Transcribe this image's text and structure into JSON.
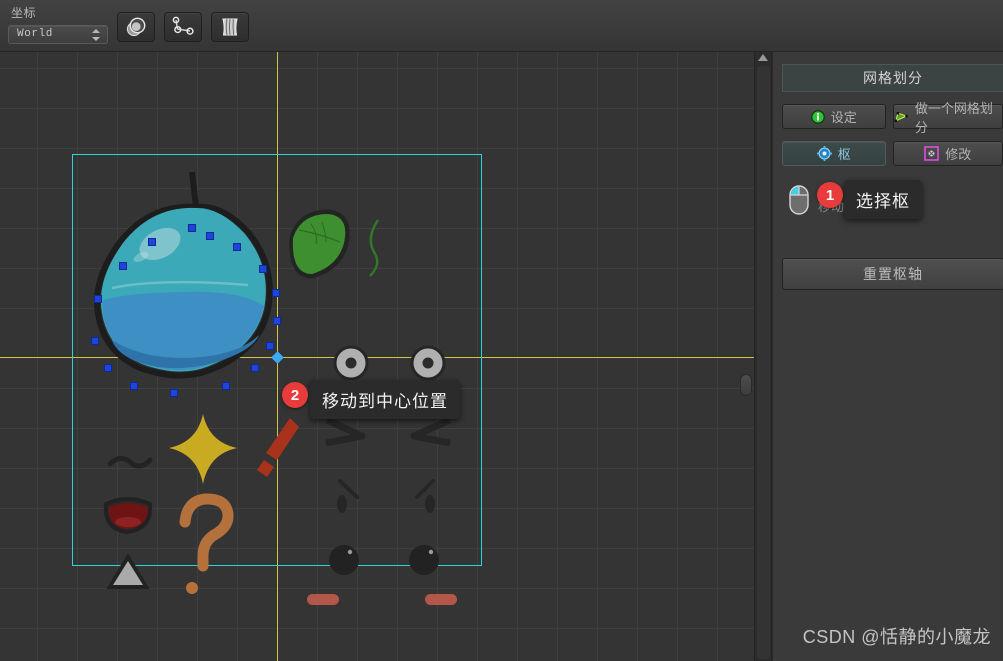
{
  "toolbar": {
    "coord_label": "坐标",
    "coord_value": "World",
    "buttons": [
      {
        "name": "shape-tool",
        "icon": "sphere-icon"
      },
      {
        "name": "bone-tool",
        "icon": "bone-chain-icon"
      },
      {
        "name": "cloth-tool",
        "icon": "cloth-mesh-icon"
      }
    ]
  },
  "panel": {
    "header": "网格划分",
    "row1": [
      {
        "label": "设定",
        "icon": "info-circle-icon",
        "active": false
      },
      {
        "label": "做一个网格划分",
        "icon": "mesh-green-icon",
        "active": false
      }
    ],
    "row2": [
      {
        "label": "枢",
        "icon": "pivot-icon",
        "active": true
      },
      {
        "label": "修改",
        "icon": "modify-icon",
        "active": false
      }
    ],
    "mouse_hint": "移动枢轴",
    "mouse_icon": "mouse-left-click-icon",
    "reset_label": "重置枢轴"
  },
  "annotations": [
    {
      "badge": "1",
      "tooltip": "选择枢"
    },
    {
      "badge": "2",
      "tooltip": "移动到中心位置"
    }
  ],
  "viewport": {
    "selection_color": "#2fd2d6",
    "axis_color": "#cfc34a",
    "handle_color": "#1e44d8",
    "pivot_color": "#3da9f5",
    "sprites": [
      {
        "name": "blue-slime",
        "selected": true
      },
      {
        "name": "green-leaf"
      },
      {
        "name": "green-stem"
      },
      {
        "name": "wavy-mouth"
      },
      {
        "name": "yellow-sparkle"
      },
      {
        "name": "red-exclamation"
      },
      {
        "name": "open-mouth"
      },
      {
        "name": "orange-question-mark"
      },
      {
        "name": "gray-triangle"
      },
      {
        "name": "eye-ring-left"
      },
      {
        "name": "eye-ring-right"
      },
      {
        "name": "angry-brow-left"
      },
      {
        "name": "angry-brow-right"
      },
      {
        "name": "lash-left"
      },
      {
        "name": "lash-right"
      },
      {
        "name": "pupil-left"
      },
      {
        "name": "pupil-right"
      },
      {
        "name": "blush-left"
      },
      {
        "name": "blush-right"
      }
    ]
  },
  "watermark": "CSDN @恬静的小魔龙"
}
